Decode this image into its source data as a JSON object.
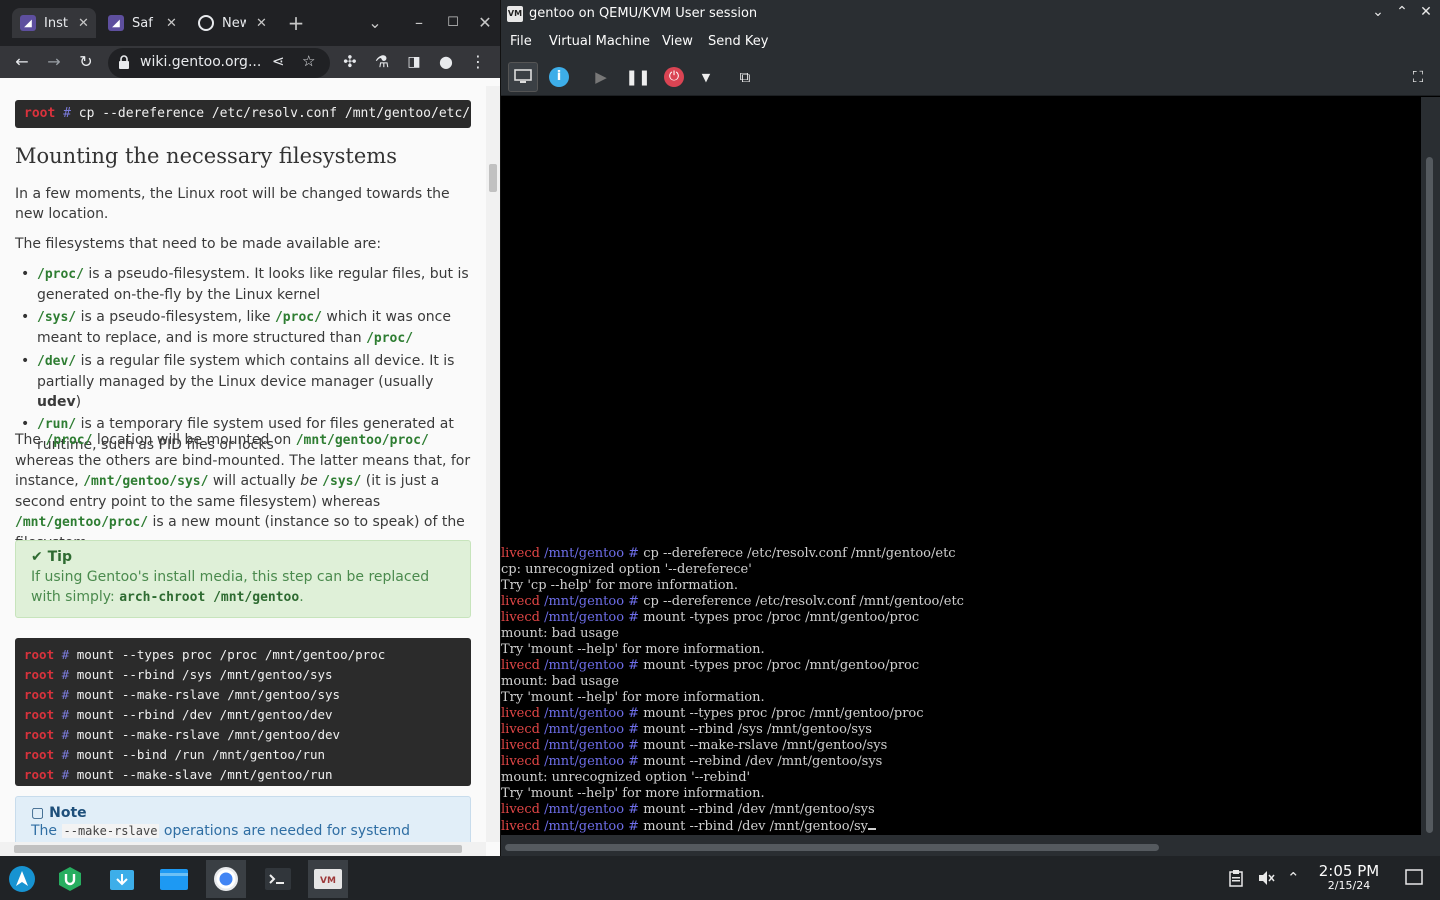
{
  "browser": {
    "tabs": [
      {
        "label": "Inst",
        "active": true
      },
      {
        "label": "Saf",
        "active": false
      },
      {
        "label": "New",
        "active": false
      }
    ],
    "url": "wiki.gentoo.org...",
    "content": {
      "code_line1": {
        "prompt": "root",
        "hash": "#",
        "cmd": "cp --dereference /etc/resolv.conf /mnt/gentoo/etc/"
      },
      "heading": "Mounting the necessary filesystems",
      "intro": "In a few moments, the Linux root will be changed towards the new location.",
      "fs_intro": "The filesystems that need to be made available are:",
      "items": [
        {
          "path": "/proc/",
          "text": " is a pseudo-filesystem. It looks like regular files, but is generated on-the-fly by the Linux kernel"
        },
        {
          "path": "/sys/",
          "text": " is a pseudo-filesystem, like ",
          "path2": "/proc/",
          "text2": " which it was once meant to replace, and is more structured than ",
          "path3": "/proc/"
        },
        {
          "path": "/dev/",
          "text": " is a regular file system which contains all device. It is partially managed by the Linux device manager (usually ",
          "bold": "udev",
          "text2": ")"
        },
        {
          "path": "/run/",
          "text": " is a temporary file system used for files generated at runtime, such as PID files or locks"
        }
      ],
      "para2": {
        "a": "The ",
        "p1": "/proc/",
        "b": " location will be mounted on ",
        "p2": "/mnt/gentoo/proc/",
        "c": " whereas the others are bind-mounted. The latter means that, for instance, ",
        "p3": "/mnt/gentoo/sys/",
        "d": " will actually ",
        "em": "be",
        "e": " ",
        "p4": "/sys/",
        "f": " (it is just a second entry point to the same filesystem) whereas ",
        "p5": "/mnt/gentoo/proc/",
        "g": " is a new mount (instance so to speak) of the filesystem."
      },
      "tip": {
        "title": "Tip",
        "text": "If using Gentoo's install media, this step can be replaced with simply: ",
        "cmd": "arch-chroot /mnt/gentoo",
        "end": "."
      },
      "code_block": {
        "prompt": "root",
        "hash": "#",
        "lines": [
          "mount --types proc /proc /mnt/gentoo/proc",
          "mount --rbind /sys /mnt/gentoo/sys",
          "mount --make-rslave /mnt/gentoo/sys",
          "mount --rbind /dev /mnt/gentoo/dev",
          "mount --make-rslave /mnt/gentoo/dev",
          "mount --bind /run /mnt/gentoo/run",
          "mount --make-slave /mnt/gentoo/run"
        ]
      },
      "note": {
        "title": "Note",
        "a": "The ",
        "code": "--make-rslave",
        "b": " operations are needed for systemd"
      }
    }
  },
  "vm": {
    "title": "gentoo on QEMU/KVM User session",
    "menu": [
      "File",
      "Virtual Machine",
      "View",
      "Send Key"
    ],
    "terminal": {
      "host": "livecd",
      "dir": "/mnt/gentoo",
      "hash": "#",
      "lines": [
        {
          "prompt": true,
          "text": "cp --dereferece /etc/resolv.conf /mnt/gentoo/etc"
        },
        {
          "prompt": false,
          "text": "cp: unrecognized option '--dereferece'"
        },
        {
          "prompt": false,
          "text": "Try 'cp --help' for more information."
        },
        {
          "prompt": true,
          "text": "cp --dereference /etc/resolv.conf /mnt/gentoo/etc"
        },
        {
          "prompt": true,
          "text": "mount -types proc /proc /mnt/gentoo/proc"
        },
        {
          "prompt": false,
          "text": "mount: bad usage"
        },
        {
          "prompt": false,
          "text": "Try 'mount --help' for more information."
        },
        {
          "prompt": true,
          "text": "mount -types proc /proc /mnt/gentoo/proc"
        },
        {
          "prompt": false,
          "text": "mount: bad usage"
        },
        {
          "prompt": false,
          "text": "Try 'mount --help' for more information."
        },
        {
          "prompt": true,
          "text": "mount --types proc /proc /mnt/gentoo/proc"
        },
        {
          "prompt": true,
          "text": "mount --rbind /sys /mnt/gentoo/sys"
        },
        {
          "prompt": true,
          "text": "mount --make-rslave /mnt/gentoo/sys"
        },
        {
          "prompt": true,
          "text": "mount --rebind /dev /mnt/gentoo/sys"
        },
        {
          "prompt": false,
          "text": "mount: unrecognized option '--rebind'"
        },
        {
          "prompt": false,
          "text": "Try 'mount --help' for more information."
        },
        {
          "prompt": true,
          "text": "mount --rbind /dev /mnt/gentoo/sys"
        },
        {
          "prompt": true,
          "text": "mount --rbind /dev /mnt/gentoo/sy",
          "cursor": true
        }
      ]
    }
  },
  "taskbar": {
    "time": "2:05 PM",
    "date": "2/15/24"
  },
  "colors": {
    "prompt_red": "#e24646",
    "prompt_blue": "#6d6de8",
    "wiki_green": "#2e7d32"
  }
}
